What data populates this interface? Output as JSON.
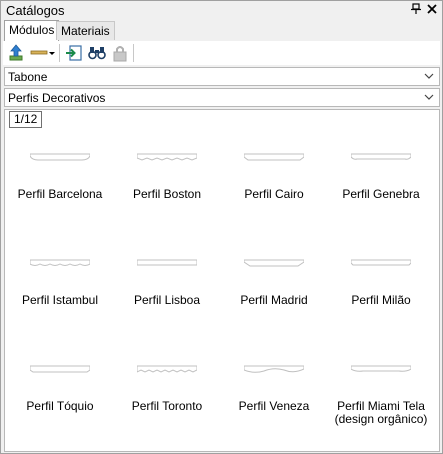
{
  "window": {
    "title": "Catálogos",
    "pin_icon": "pin-icon",
    "close_icon": "close-icon"
  },
  "tabs": [
    {
      "label": "Módulos",
      "active": true
    },
    {
      "label": "Materiais",
      "active": false
    }
  ],
  "toolbar": {
    "icons": [
      "import-up-arrow-icon",
      "profile-dropdown-icon",
      "insert-icon",
      "binoculars-search-icon",
      "lock-disabled-icon"
    ]
  },
  "catalog_select": {
    "value": "Tabone"
  },
  "category_select": {
    "value": "Perfis Decorativos"
  },
  "pager": {
    "label": "1/12"
  },
  "items": [
    {
      "label": "Perfil Barcelona"
    },
    {
      "label": "Perfil Boston"
    },
    {
      "label": "Perfil Cairo"
    },
    {
      "label": "Perfil Genebra"
    },
    {
      "label": "Perfil Istambul"
    },
    {
      "label": "Perfil Lisboa"
    },
    {
      "label": "Perfil Madrid"
    },
    {
      "label": "Perfil Milão"
    },
    {
      "label": "Perfil Tóquio"
    },
    {
      "label": "Perfil Toronto"
    },
    {
      "label": "Perfil Veneza"
    },
    {
      "label": "Perfil Miami Tela (design orgânico)"
    }
  ]
}
